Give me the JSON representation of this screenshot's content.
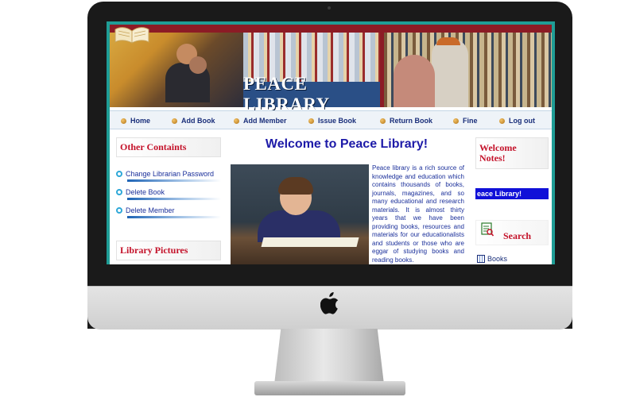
{
  "site": {
    "title": "PEACE LIBRARY"
  },
  "nav": [
    {
      "label": "Home"
    },
    {
      "label": "Add Book"
    },
    {
      "label": "Add Member"
    },
    {
      "label": "Issue Book"
    },
    {
      "label": "Return Book"
    },
    {
      "label": "Fine"
    },
    {
      "label": "Log out"
    }
  ],
  "left": {
    "heading": "Other Containts",
    "links": [
      {
        "label": "Change Librarian Password"
      },
      {
        "label": "Delete Book"
      },
      {
        "label": "Delete Member"
      }
    ],
    "pictures_heading": "Library Pictures"
  },
  "main": {
    "welcome": "Welcome to Peace Library!",
    "intro": "Peace library is a rich source of knowledge and education which contains thousands of books, journals, magazines, and so many educational and research materials. It is almost thirty years that we have been providing books, resources and materials for our educationalists and students or those who are eggar of studying books and reading books."
  },
  "right": {
    "notes_heading": "Welcome Notes!",
    "marquee": "eace Library!",
    "search_label": "Search",
    "books_label": "Books"
  },
  "colors": {
    "accent_red": "#c4122a",
    "link_blue": "#1a2f9a",
    "banner": "#8c1b25",
    "frame_teal": "#1f9d96"
  },
  "icons": [
    "apple-logo-icon",
    "open-book-icon",
    "nav-bullet-icon",
    "ring-bullet-icon",
    "search-icon",
    "books-icon"
  ]
}
